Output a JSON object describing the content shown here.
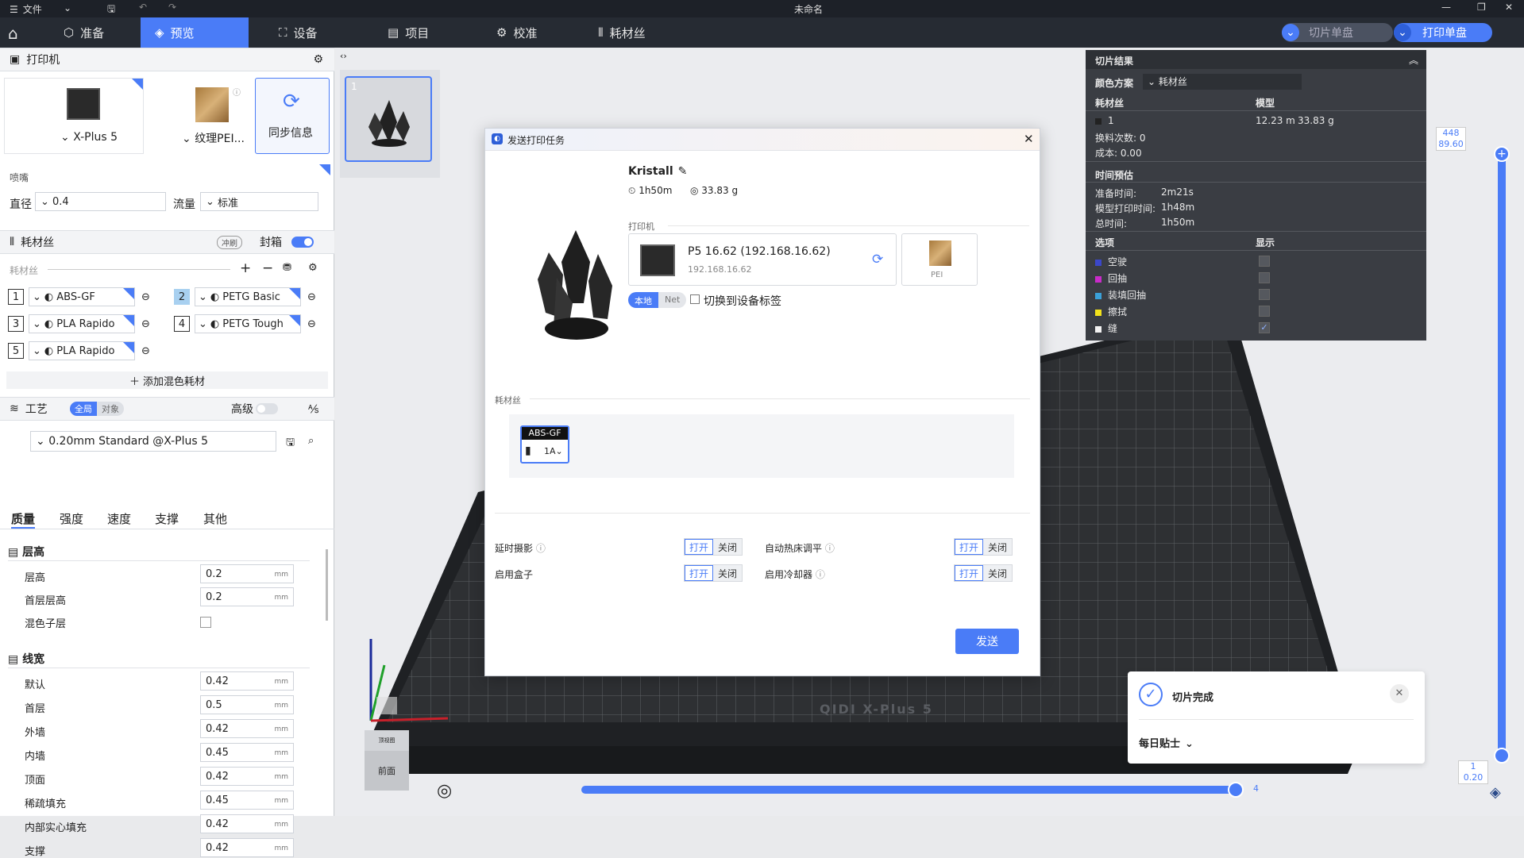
{
  "window": {
    "title": "未命名",
    "menu": "文件"
  },
  "nav": {
    "tabs": [
      "准备",
      "预览",
      "设备",
      "项目",
      "校准",
      "耗材丝"
    ],
    "active": 1,
    "slice_btn": "切片单盘",
    "print_btn": "打印单盘"
  },
  "printer": {
    "header": "打印机",
    "name": "X-Plus 5",
    "plate": "纹理PEI...",
    "sync": "同步信息",
    "nozzle_label": "喷嘴",
    "diameter_label": "直径",
    "diameter": "0.4",
    "flow_label": "流量",
    "flow": "标准"
  },
  "filament": {
    "header": "耗材丝",
    "flush": "冲刷",
    "seal": "封箱",
    "sub": "耗材丝",
    "add_mix": "添加混色耗材",
    "items": [
      {
        "n": "1",
        "name": "ABS-GF"
      },
      {
        "n": "2",
        "name": "PETG Basic"
      },
      {
        "n": "3",
        "name": "PLA Rapido"
      },
      {
        "n": "4",
        "name": "PETG Tough"
      },
      {
        "n": "5",
        "name": "PLA Rapido"
      }
    ]
  },
  "process": {
    "header": "工艺",
    "global": "全局",
    "object": "对象",
    "advanced": "高级",
    "preset": "0.20mm Standard @X-Plus 5",
    "tabs": [
      "质量",
      "强度",
      "速度",
      "支撑",
      "其他"
    ],
    "layer_section": "层高",
    "layer": [
      {
        "label": "层高",
        "value": "0.2"
      },
      {
        "label": "首层层高",
        "value": "0.2"
      }
    ],
    "mix_sub": "混色子层",
    "width_section": "线宽",
    "widths": [
      {
        "label": "默认",
        "value": "0.42"
      },
      {
        "label": "首层",
        "value": "0.5"
      },
      {
        "label": "外墙",
        "value": "0.42"
      },
      {
        "label": "内墙",
        "value": "0.45"
      },
      {
        "label": "顶面",
        "value": "0.42"
      },
      {
        "label": "稀疏填充",
        "value": "0.45"
      },
      {
        "label": "内部实心填充",
        "value": "0.42"
      },
      {
        "label": "支撑",
        "value": "0.42"
      }
    ],
    "unit": "mm"
  },
  "plate": {
    "number": "1"
  },
  "dialog": {
    "title": "发送打印任务",
    "model": "Kristall",
    "time": "1h50m",
    "weight": "33.83 g",
    "printer_label": "打印机",
    "printer_name": "P5 16.62 (192.168.16.62)",
    "printer_ip": "192.168.16.62",
    "plate": "PEI",
    "local": "本地",
    "net": "Net",
    "switch_tag": "切换到设备标签",
    "filament_label": "耗材丝",
    "fil_name": "ABS-GF",
    "fil_slot": "1A",
    "options": [
      {
        "label": "延时摄影",
        "on": "打开",
        "off": "关闭"
      },
      {
        "label": "自动热床调平",
        "on": "打开",
        "off": "关闭"
      },
      {
        "label": "启用盒子",
        "on": "打开",
        "off": "关闭"
      },
      {
        "label": "启用冷却器",
        "on": "打开",
        "off": "关闭"
      }
    ],
    "send": "发送"
  },
  "slice": {
    "title": "切片结果",
    "scheme_label": "颜色方案",
    "scheme": "耗材丝",
    "fil_col": "耗材丝",
    "model_col": "模型",
    "fil_row": {
      "n": "1",
      "len": "12.23 m",
      "weight": "33.83 g"
    },
    "changes": "换料次数:  0",
    "cost": "成本:  0.00",
    "time_title": "时间预估",
    "prep_label": "准备时间:",
    "prep": "2m21s",
    "model_time_label": "模型打印时间:",
    "model_time": "1h48m",
    "total_label": "总时间:",
    "total": "1h50m",
    "opt_col": "选项",
    "show_col": "显示",
    "options": [
      {
        "label": "空驶",
        "color": "#3b47c9"
      },
      {
        "label": "回抽",
        "color": "#c92bc9"
      },
      {
        "label": "装填回抽",
        "color": "#3aa0d8"
      },
      {
        "label": "擦拭",
        "color": "#f2e21b"
      },
      {
        "label": "缝",
        "color": "#f2f2f2"
      }
    ]
  },
  "vslider": {
    "top_layer": "448",
    "top_z": "89.60",
    "bot_layer": "1",
    "bot_z": "0.20"
  },
  "hslider": {
    "value": "4"
  },
  "toast": {
    "title": "切片完成",
    "tip": "每日贴士"
  },
  "cube": {
    "top": "顶视图",
    "front": "前面"
  },
  "bed": {
    "brand": "QIDI  X-Plus 5"
  }
}
